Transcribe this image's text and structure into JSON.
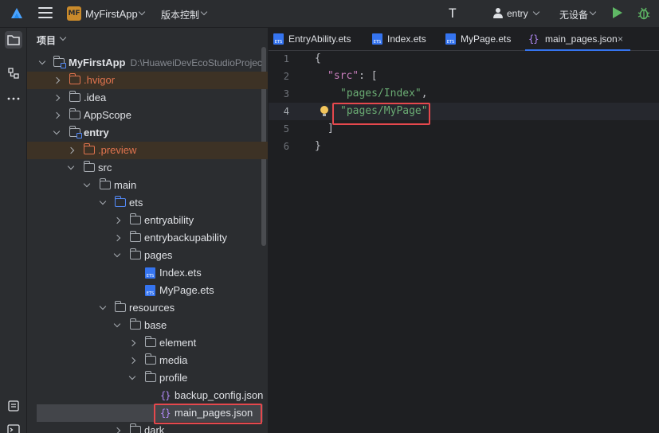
{
  "toolbar": {
    "project_badge": "MF",
    "project_name": "MyFirstApp",
    "vcs_label": "版本控制",
    "module_name": "entry",
    "device_label": "无设备"
  },
  "colors": {
    "accent": "#3574f0",
    "run_green": "#5fb865",
    "highlight_red": "#e5484d",
    "excluded_orange": "#e0734e",
    "json_purple": "#b189f5"
  },
  "panel": {
    "title": "项目"
  },
  "tree": [
    {
      "label": "MyFirstApp",
      "path": "D:\\HuaweiDevEcoStudioProjec",
      "icon": "module-folder-icon"
    },
    {
      "label": ".hvigor",
      "icon": "folder-icon"
    },
    {
      "label": ".idea",
      "icon": "folder-icon"
    },
    {
      "label": "AppScope",
      "icon": "folder-icon"
    },
    {
      "label": "entry",
      "icon": "module-folder-icon"
    },
    {
      "label": ".preview",
      "icon": "folder-icon"
    },
    {
      "label": "src",
      "icon": "folder-icon"
    },
    {
      "label": "main",
      "icon": "folder-icon"
    },
    {
      "label": "ets",
      "icon": "source-folder-icon"
    },
    {
      "label": "entryability",
      "icon": "folder-icon"
    },
    {
      "label": "entrybackupability",
      "icon": "folder-icon"
    },
    {
      "label": "pages",
      "icon": "folder-icon"
    },
    {
      "label": "Index.ets",
      "icon": "ets-file-icon"
    },
    {
      "label": "MyPage.ets",
      "icon": "ets-file-icon"
    },
    {
      "label": "resources",
      "icon": "folder-icon"
    },
    {
      "label": "base",
      "icon": "folder-icon"
    },
    {
      "label": "element",
      "icon": "folder-icon"
    },
    {
      "label": "media",
      "icon": "folder-icon"
    },
    {
      "label": "profile",
      "icon": "folder-icon"
    },
    {
      "label": "backup_config.json",
      "icon": "json-file-icon"
    },
    {
      "label": "main_pages.json",
      "icon": "json-file-icon"
    },
    {
      "label": "dark",
      "icon": "folder-icon"
    }
  ],
  "tabs": [
    {
      "label": "EntryAbility.ets",
      "icon": "ets-file-icon"
    },
    {
      "label": "Index.ets",
      "icon": "ets-file-icon"
    },
    {
      "label": "MyPage.ets",
      "icon": "ets-file-icon"
    },
    {
      "label": "main_pages.json",
      "icon": "json-file-icon",
      "close": "×"
    }
  ],
  "json_glyph": "{}",
  "editor": {
    "line_numbers": [
      "1",
      "2",
      "3",
      "4",
      "5",
      "6"
    ],
    "code": {
      "l1": "{",
      "l2_key": "\"src\"",
      "l2_rest": ": [",
      "l3_str": "\"pages/Index\"",
      "l3_rest": ",",
      "l4_str": "\"pages/MyPage\"",
      "l5": "]",
      "l6": "}"
    }
  }
}
